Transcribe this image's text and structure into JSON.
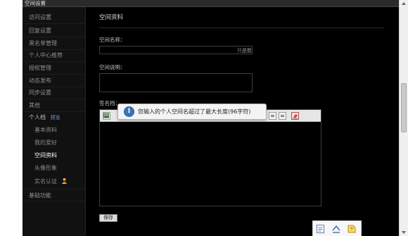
{
  "window": {
    "title": "空间设置"
  },
  "sidebar": {
    "items": [
      {
        "label": "访问设置"
      },
      {
        "label": "回复设置"
      },
      {
        "label": "黑名单管理"
      },
      {
        "label": "个人中心推荐"
      },
      {
        "label": "授权管理"
      },
      {
        "label": "动态发布"
      },
      {
        "label": "同步设置"
      },
      {
        "label": "其他"
      }
    ],
    "personal": {
      "label": "个人档",
      "link": "预览"
    },
    "sub_items": [
      {
        "label": "基本资料"
      },
      {
        "label": "我的爱好"
      },
      {
        "label": "空间资料"
      },
      {
        "label": "头像形象"
      },
      {
        "label": "实名认证"
      }
    ],
    "last_item": {
      "label": "基础功能"
    },
    "active": "空间资料"
  },
  "main": {
    "title": "空间资料",
    "name_label": "空间名称：",
    "char_limit": "只是数",
    "desc_label": "空间说明：",
    "signature_label": "签名档：",
    "save_label": "保存"
  },
  "tooltip": {
    "message": "您输入的个人空间名超过了最大长度(96字符)",
    "icon": "info-icon"
  },
  "colors": {
    "background": "#000000",
    "sidebar": "#111111",
    "tooltip_icon": "#3a73b8",
    "link": "#6d9ad1"
  }
}
